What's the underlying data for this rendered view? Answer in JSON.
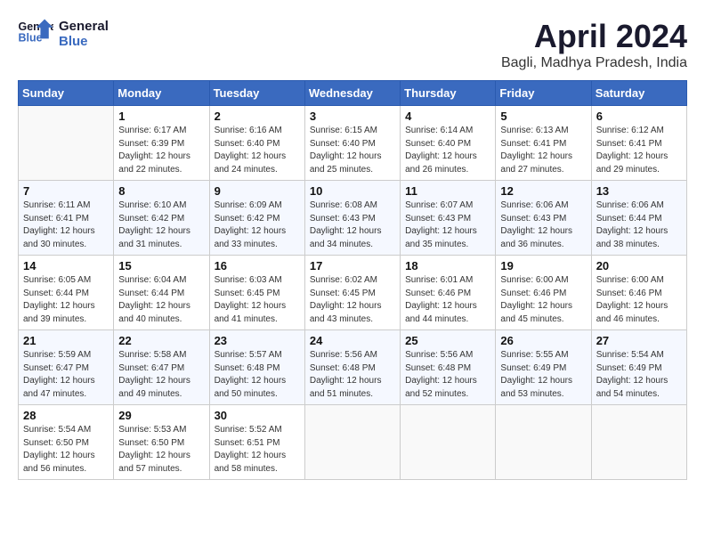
{
  "header": {
    "logo_text_top": "General",
    "logo_text_bottom": "Blue",
    "month": "April 2024",
    "location": "Bagli, Madhya Pradesh, India"
  },
  "calendar": {
    "weekdays": [
      "Sunday",
      "Monday",
      "Tuesday",
      "Wednesday",
      "Thursday",
      "Friday",
      "Saturday"
    ],
    "weeks": [
      [
        {
          "day": "",
          "info": ""
        },
        {
          "day": "1",
          "info": "Sunrise: 6:17 AM\nSunset: 6:39 PM\nDaylight: 12 hours\nand 22 minutes."
        },
        {
          "day": "2",
          "info": "Sunrise: 6:16 AM\nSunset: 6:40 PM\nDaylight: 12 hours\nand 24 minutes."
        },
        {
          "day": "3",
          "info": "Sunrise: 6:15 AM\nSunset: 6:40 PM\nDaylight: 12 hours\nand 25 minutes."
        },
        {
          "day": "4",
          "info": "Sunrise: 6:14 AM\nSunset: 6:40 PM\nDaylight: 12 hours\nand 26 minutes."
        },
        {
          "day": "5",
          "info": "Sunrise: 6:13 AM\nSunset: 6:41 PM\nDaylight: 12 hours\nand 27 minutes."
        },
        {
          "day": "6",
          "info": "Sunrise: 6:12 AM\nSunset: 6:41 PM\nDaylight: 12 hours\nand 29 minutes."
        }
      ],
      [
        {
          "day": "7",
          "info": "Sunrise: 6:11 AM\nSunset: 6:41 PM\nDaylight: 12 hours\nand 30 minutes."
        },
        {
          "day": "8",
          "info": "Sunrise: 6:10 AM\nSunset: 6:42 PM\nDaylight: 12 hours\nand 31 minutes."
        },
        {
          "day": "9",
          "info": "Sunrise: 6:09 AM\nSunset: 6:42 PM\nDaylight: 12 hours\nand 33 minutes."
        },
        {
          "day": "10",
          "info": "Sunrise: 6:08 AM\nSunset: 6:43 PM\nDaylight: 12 hours\nand 34 minutes."
        },
        {
          "day": "11",
          "info": "Sunrise: 6:07 AM\nSunset: 6:43 PM\nDaylight: 12 hours\nand 35 minutes."
        },
        {
          "day": "12",
          "info": "Sunrise: 6:06 AM\nSunset: 6:43 PM\nDaylight: 12 hours\nand 36 minutes."
        },
        {
          "day": "13",
          "info": "Sunrise: 6:06 AM\nSunset: 6:44 PM\nDaylight: 12 hours\nand 38 minutes."
        }
      ],
      [
        {
          "day": "14",
          "info": "Sunrise: 6:05 AM\nSunset: 6:44 PM\nDaylight: 12 hours\nand 39 minutes."
        },
        {
          "day": "15",
          "info": "Sunrise: 6:04 AM\nSunset: 6:44 PM\nDaylight: 12 hours\nand 40 minutes."
        },
        {
          "day": "16",
          "info": "Sunrise: 6:03 AM\nSunset: 6:45 PM\nDaylight: 12 hours\nand 41 minutes."
        },
        {
          "day": "17",
          "info": "Sunrise: 6:02 AM\nSunset: 6:45 PM\nDaylight: 12 hours\nand 43 minutes."
        },
        {
          "day": "18",
          "info": "Sunrise: 6:01 AM\nSunset: 6:46 PM\nDaylight: 12 hours\nand 44 minutes."
        },
        {
          "day": "19",
          "info": "Sunrise: 6:00 AM\nSunset: 6:46 PM\nDaylight: 12 hours\nand 45 minutes."
        },
        {
          "day": "20",
          "info": "Sunrise: 6:00 AM\nSunset: 6:46 PM\nDaylight: 12 hours\nand 46 minutes."
        }
      ],
      [
        {
          "day": "21",
          "info": "Sunrise: 5:59 AM\nSunset: 6:47 PM\nDaylight: 12 hours\nand 47 minutes."
        },
        {
          "day": "22",
          "info": "Sunrise: 5:58 AM\nSunset: 6:47 PM\nDaylight: 12 hours\nand 49 minutes."
        },
        {
          "day": "23",
          "info": "Sunrise: 5:57 AM\nSunset: 6:48 PM\nDaylight: 12 hours\nand 50 minutes."
        },
        {
          "day": "24",
          "info": "Sunrise: 5:56 AM\nSunset: 6:48 PM\nDaylight: 12 hours\nand 51 minutes."
        },
        {
          "day": "25",
          "info": "Sunrise: 5:56 AM\nSunset: 6:48 PM\nDaylight: 12 hours\nand 52 minutes."
        },
        {
          "day": "26",
          "info": "Sunrise: 5:55 AM\nSunset: 6:49 PM\nDaylight: 12 hours\nand 53 minutes."
        },
        {
          "day": "27",
          "info": "Sunrise: 5:54 AM\nSunset: 6:49 PM\nDaylight: 12 hours\nand 54 minutes."
        }
      ],
      [
        {
          "day": "28",
          "info": "Sunrise: 5:54 AM\nSunset: 6:50 PM\nDaylight: 12 hours\nand 56 minutes."
        },
        {
          "day": "29",
          "info": "Sunrise: 5:53 AM\nSunset: 6:50 PM\nDaylight: 12 hours\nand 57 minutes."
        },
        {
          "day": "30",
          "info": "Sunrise: 5:52 AM\nSunset: 6:51 PM\nDaylight: 12 hours\nand 58 minutes."
        },
        {
          "day": "",
          "info": ""
        },
        {
          "day": "",
          "info": ""
        },
        {
          "day": "",
          "info": ""
        },
        {
          "day": "",
          "info": ""
        }
      ]
    ]
  }
}
